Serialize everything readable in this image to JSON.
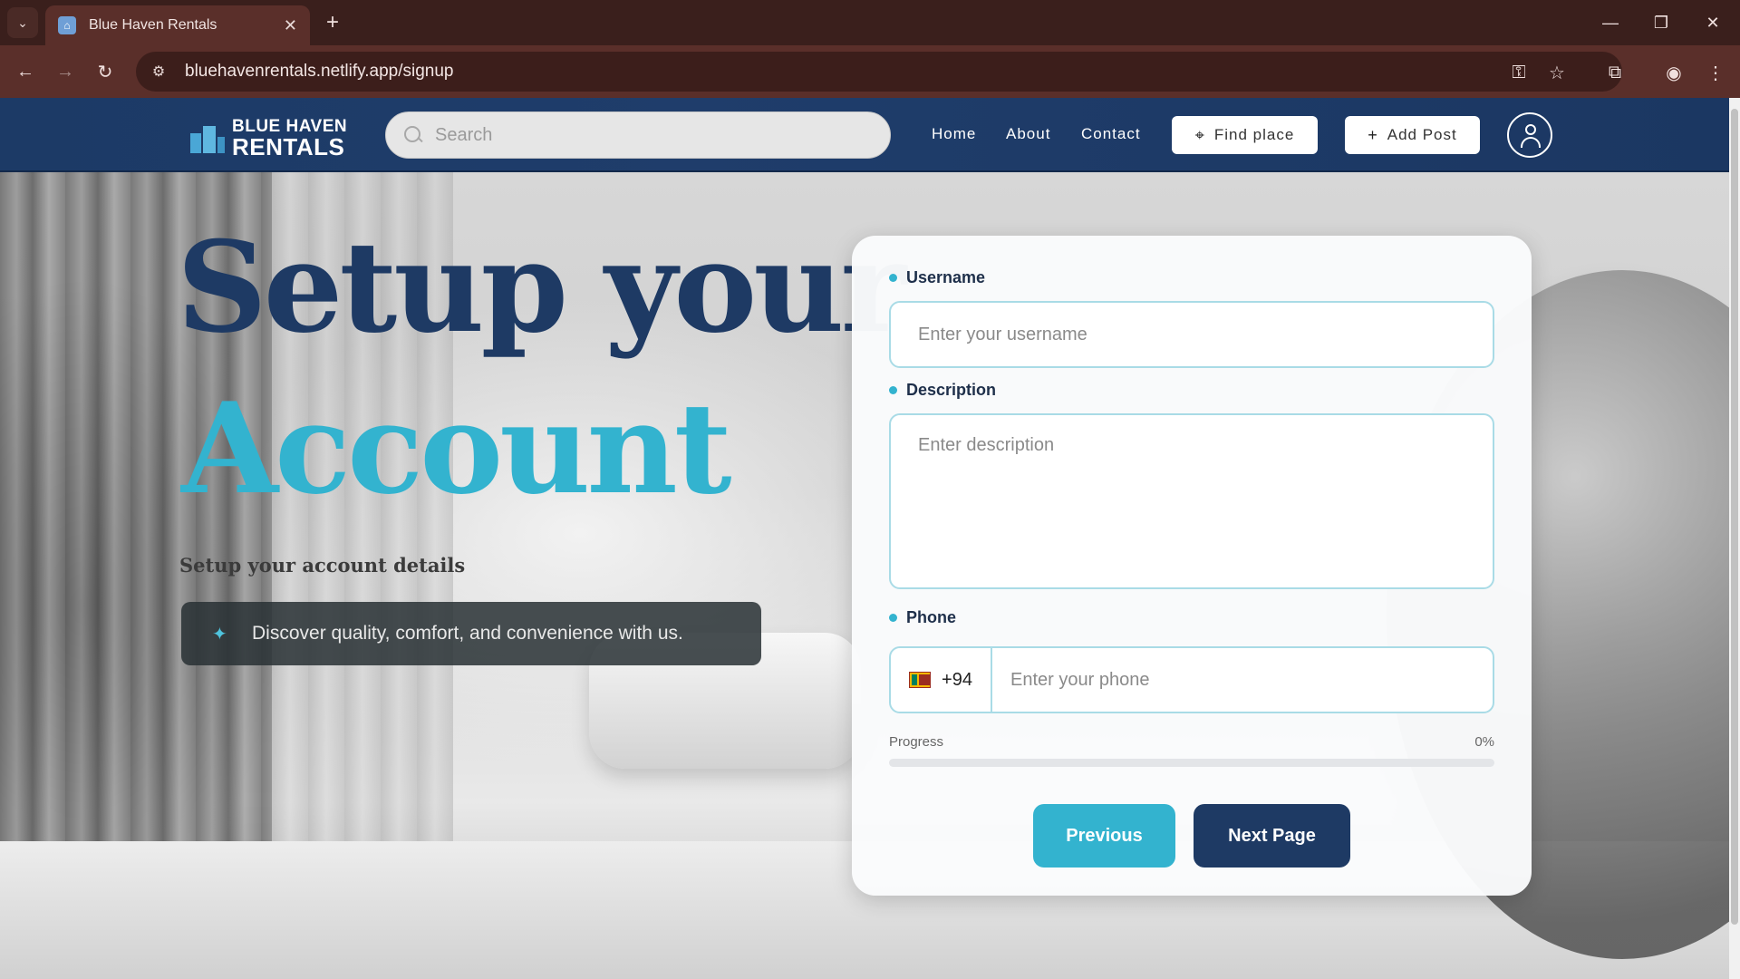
{
  "browser": {
    "tab_title": "Blue Haven Rentals",
    "url": "bluehavenrentals.netlify.app/signup"
  },
  "header": {
    "logo_line1": "BLUE HAVEN",
    "logo_line2": "RENTALS",
    "search_placeholder": "Search",
    "nav": [
      "Home",
      "About",
      "Contact"
    ],
    "find_place": "Find place",
    "add_post": "Add Post"
  },
  "hero": {
    "title_line1": "Setup your",
    "title_line2": "Account",
    "subtitle": "Setup your account details",
    "tagline": "Discover quality, comfort, and convenience with us."
  },
  "form": {
    "username_label": "Username",
    "username_placeholder": "Enter your username",
    "description_label": "Description",
    "description_placeholder": "Enter description",
    "phone_label": "Phone",
    "country_code": "+94",
    "phone_placeholder": "Enter your phone",
    "progress_label": "Progress",
    "progress_text": "0%",
    "progress_value": 0,
    "previous_label": "Previous",
    "next_label": "Next Page"
  },
  "colors": {
    "navy": "#1e3a64",
    "accent": "#33b3cf"
  }
}
